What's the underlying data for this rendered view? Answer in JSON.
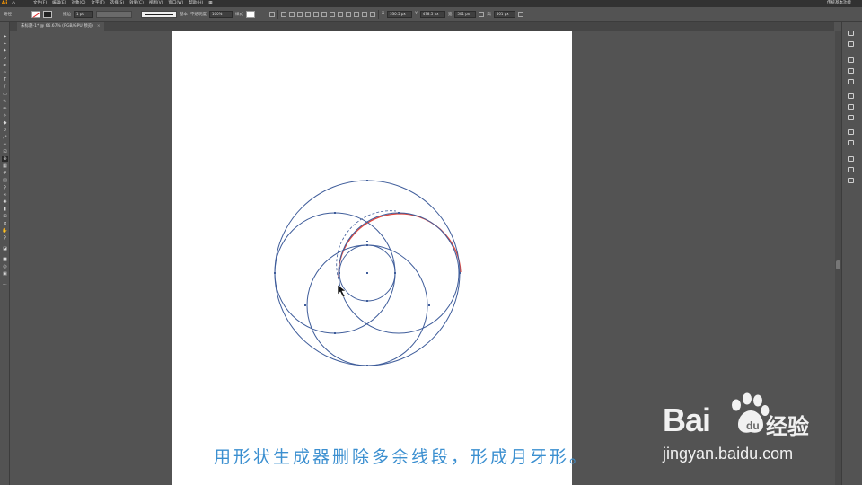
{
  "app": {
    "logo": "Ai",
    "menus": [
      "文件(F)",
      "编辑(E)",
      "对象(O)",
      "文字(T)",
      "选择(S)",
      "效果(C)",
      "视图(V)",
      "窗口(W)",
      "帮助(H)"
    ],
    "right_label": "传统基本功能"
  },
  "control_bar": {
    "object_label": "路径",
    "stroke_label": "描边",
    "stroke_weight": "1 pt",
    "stroke_style": "基本",
    "opacity_label": "不透明度",
    "opacity_value": "100%",
    "style_label": "样式",
    "x_label": "X",
    "x_value": "530.5 px",
    "y_label": "Y",
    "y_value": "478.5 px",
    "w_label": "宽",
    "w_value": "501 px",
    "h_label": "高",
    "h_value": "501 px"
  },
  "document_tab": {
    "title": "未标题-1* @ 66.67% (RGB/GPU 预览)",
    "close": "×"
  },
  "caption": "用形状生成器删除多余线段，形成月牙形。",
  "watermark": {
    "logo": "Bai",
    "logo_suffix": "du",
    "cn": "经验",
    "url": "jingyan.baidu.com"
  },
  "colors": {
    "circle_stroke": "#3e5c9a",
    "crescent_stroke": "#e0463c",
    "caption": "#3b8fd0",
    "ui_dark": "#535353"
  }
}
